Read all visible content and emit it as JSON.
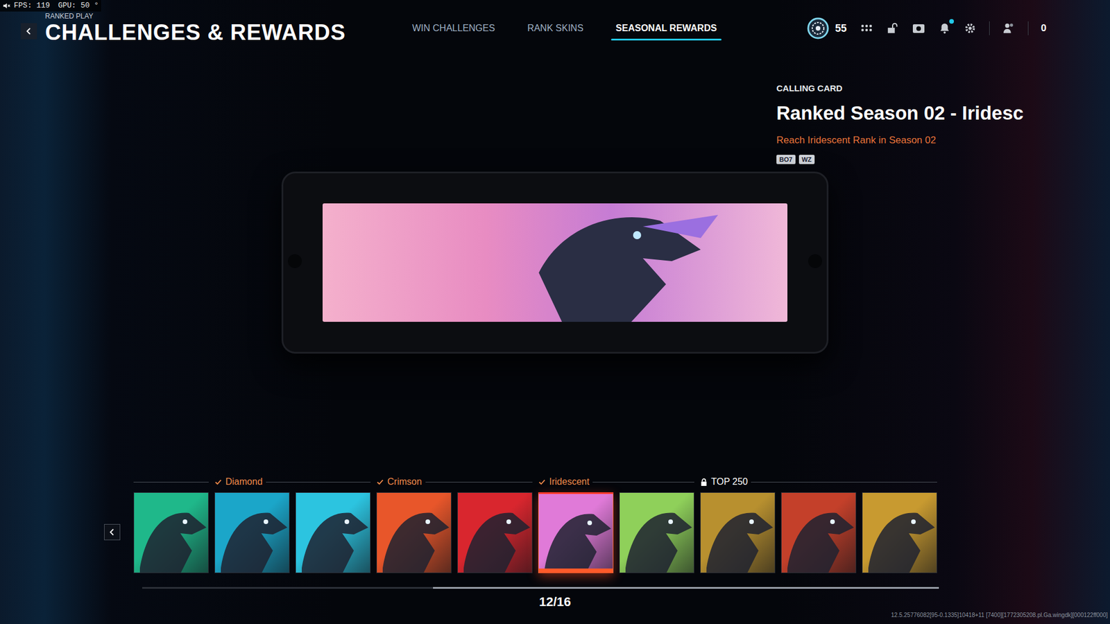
{
  "hud": {
    "fps": "FPS: 119",
    "gpu": "GPU: 50 °",
    "muted": true
  },
  "header": {
    "breadcrumb": "RANKED PLAY",
    "title": "CHALLENGES & REWARDS"
  },
  "tabs": [
    {
      "label": "WIN CHALLENGES",
      "selected": false
    },
    {
      "label": "RANK SKINS",
      "selected": false
    },
    {
      "label": "SEASONAL REWARDS",
      "selected": true
    }
  ],
  "topbar": {
    "rank_level": "55",
    "currency": "0",
    "notification": true
  },
  "item": {
    "type": "CALLING CARD",
    "title": "Ranked Season 02 - Iridesc",
    "requirement": "Reach Iridescent Rank in Season 02",
    "games": [
      "BO7",
      "WZ"
    ]
  },
  "reward_groups": [
    {
      "completed": true,
      "locked": false,
      "items": [
        {
          "color": "#1fb88a",
          "selected": false
        }
      ]
    },
    {
      "label": "Diamond",
      "completed": true,
      "locked": false,
      "items": [
        {
          "color": "#1ba6c9",
          "selected": false
        },
        {
          "color": "#2cc4e0",
          "selected": false
        }
      ]
    },
    {
      "label": "Crimson",
      "completed": true,
      "locked": false,
      "items": [
        {
          "color": "#e8562a",
          "selected": false
        },
        {
          "color": "#d9262e",
          "selected": false
        }
      ]
    },
    {
      "label": "Iridescent",
      "completed": true,
      "locked": false,
      "items": [
        {
          "color": "#e07ad8",
          "selected": true
        },
        {
          "color": "#8fd05a",
          "selected": false
        }
      ]
    },
    {
      "label": "TOP 250",
      "completed": false,
      "locked": true,
      "items": [
        {
          "color": "#b8902f",
          "selected": false
        },
        {
          "color": "#c4402a",
          "selected": false
        },
        {
          "color": "#c89a30",
          "selected": false
        }
      ]
    }
  ],
  "scrollbar": {
    "offset": 0.365,
    "level": 0.635
  },
  "counter": "12/16",
  "build": "12.5.25776082[95-0.1335]10418+11 [7400][1772305208.pl.Ga.wingdk][000122ff000]"
}
